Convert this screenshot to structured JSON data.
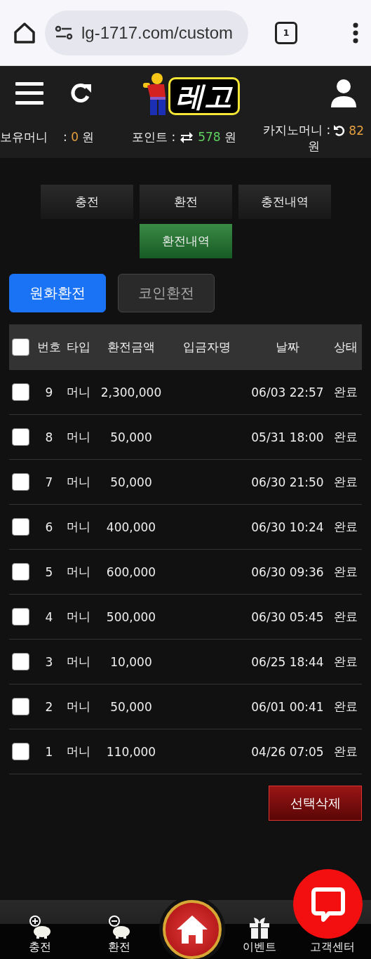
{
  "browser": {
    "url": "lg-1717.com/custom",
    "tab_count": "1"
  },
  "header": {
    "logo_text": "레고",
    "balance": {
      "label": "보유머니",
      "sep": ":",
      "value": "0",
      "unit": "원"
    },
    "point": {
      "label": "포인트 :",
      "value": "578",
      "unit": "원"
    },
    "casino": {
      "label": "카지노머니 :",
      "value": "82",
      "unit": "원"
    }
  },
  "menu_buttons": [
    {
      "label": "충전",
      "selected": false
    },
    {
      "label": "환전",
      "selected": false
    },
    {
      "label": "충전내역",
      "selected": false
    },
    {
      "label": "환전내역",
      "selected": true
    }
  ],
  "currency_tabs": [
    {
      "label": "원화환전",
      "selected": true
    },
    {
      "label": "코인환전",
      "selected": false
    }
  ],
  "table": {
    "select_all_checked": false,
    "columns": [
      "번호",
      "타입",
      "환전금액",
      "입금자명",
      "날짜",
      "상태"
    ],
    "rows": [
      {
        "checked": false,
        "no": "9",
        "type": "머니",
        "amount": "2,300,000",
        "date": "06/03 22:57",
        "status": "완료"
      },
      {
        "checked": false,
        "no": "8",
        "type": "머니",
        "amount": "50,000",
        "date": "05/31 18:00",
        "status": "완료"
      },
      {
        "checked": false,
        "no": "7",
        "type": "머니",
        "amount": "50,000",
        "date": "06/30 21:50",
        "status": "완료"
      },
      {
        "checked": false,
        "no": "6",
        "type": "머니",
        "amount": "400,000",
        "date": "06/30 10:24",
        "status": "완료"
      },
      {
        "checked": false,
        "no": "5",
        "type": "머니",
        "amount": "600,000",
        "date": "06/30 09:36",
        "status": "완료"
      },
      {
        "checked": false,
        "no": "4",
        "type": "머니",
        "amount": "500,000",
        "date": "06/30 05:45",
        "status": "완료"
      },
      {
        "checked": false,
        "no": "3",
        "type": "머니",
        "amount": "10,000",
        "date": "06/25 18:44",
        "status": "완료"
      },
      {
        "checked": false,
        "no": "2",
        "type": "머니",
        "amount": "50,000",
        "date": "06/01 00:41",
        "status": "완료"
      },
      {
        "checked": false,
        "no": "1",
        "type": "머니",
        "amount": "110,000",
        "date": "04/26 07:05",
        "status": "완료"
      }
    ]
  },
  "delete_button": "선택삭제",
  "bottom_nav": [
    {
      "kind": "deposit",
      "label": "충전"
    },
    {
      "kind": "withdraw",
      "label": "환전"
    },
    {
      "kind": "home"
    },
    {
      "kind": "event",
      "label": "이벤트"
    },
    {
      "kind": "support",
      "label": "고객센터"
    }
  ]
}
